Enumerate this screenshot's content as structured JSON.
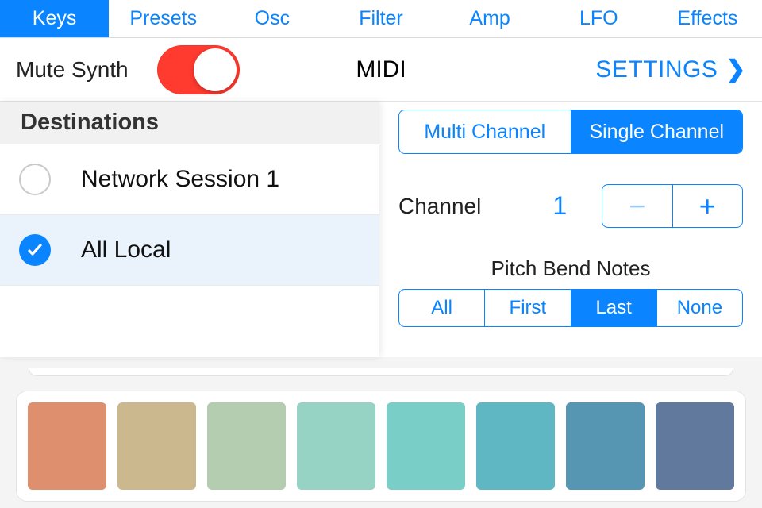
{
  "tabs": {
    "items": [
      "Keys",
      "Presets",
      "Osc",
      "Filter",
      "Amp",
      "LFO",
      "Effects"
    ],
    "active_index": 0
  },
  "subbar": {
    "mute_label": "Mute Synth",
    "mute_on": true,
    "center_label": "MIDI",
    "settings_label": "SETTINGS"
  },
  "destinations": {
    "header": "Destinations",
    "items": [
      {
        "label": "Network Session 1",
        "selected": false
      },
      {
        "label": "All Local",
        "selected": true
      }
    ]
  },
  "channel_mode": {
    "options": [
      "Multi Channel",
      "Single Channel"
    ],
    "active_index": 1
  },
  "channel": {
    "label": "Channel",
    "value": "1"
  },
  "pitch_bend": {
    "title": "Pitch Bend Notes",
    "options": [
      "All",
      "First",
      "Last",
      "None"
    ],
    "active_index": 2
  },
  "palette": {
    "swatches": [
      "#de8f6d",
      "#cbb88f",
      "#b4cdb1",
      "#96d3c5",
      "#79cec8",
      "#5fb7c4",
      "#5796b3",
      "#60799c"
    ]
  }
}
